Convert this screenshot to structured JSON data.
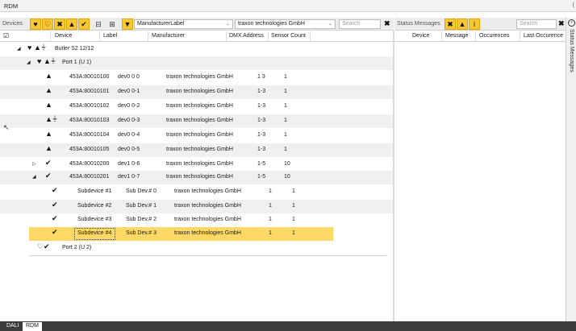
{
  "window": {
    "title": "RDM",
    "corner": "("
  },
  "toolbar": {
    "devices_label": "Devices",
    "filter_icons": [
      "heart-icon",
      "heart-outline-icon",
      "error-icon",
      "warning-icon",
      "check-icon"
    ],
    "combo1": "ManufacturerLabel",
    "combo2": "traxon technologies GmbH",
    "search_placeholder": "Search",
    "accent": "#f7c733"
  },
  "columns": [
    "Device",
    "Label",
    "Manufacturer",
    "DMX Address",
    "Sensor Count"
  ],
  "tree": {
    "root": "Butler S2 12/12",
    "port1": "Port 1 (U 1)",
    "port2": "Port 2 (U 2)"
  },
  "devices": [
    {
      "device": "453A:80010100",
      "label": "dev0 0 0",
      "manufacturer": "traxon technologies GmbH",
      "dmx": "1 3",
      "sensors": "1"
    },
    {
      "device": "453A:80010101",
      "label": "dev0 0-1",
      "manufacturer": "traxon technologies GmbH",
      "dmx": "1-3",
      "sensors": "1"
    },
    {
      "device": "453A:80010102",
      "label": "dev0 0-2",
      "manufacturer": "traxon technologies GmbH",
      "dmx": "1-3",
      "sensors": "1"
    },
    {
      "device": "453A:80010103",
      "label": "dev0 0-3",
      "manufacturer": "traxon technologies GmbH",
      "dmx": "1-3",
      "sensors": "1"
    },
    {
      "device": "453A:80010104",
      "label": "dev0 0-4",
      "manufacturer": "traxon technologies GmbH",
      "dmx": "1-3",
      "sensors": "1"
    },
    {
      "device": "453A:80010105",
      "label": "dev0 0-5",
      "manufacturer": "traxon technologies GmbH",
      "dmx": "1-3",
      "sensors": "1"
    },
    {
      "device": "453A:80010200",
      "label": "dev1 0-6",
      "manufacturer": "traxon technologies GmbH",
      "dmx": "1-5",
      "sensors": "10"
    },
    {
      "device": "453A:80010201",
      "label": "dev1 0-7",
      "manufacturer": "traxon technologies GmbH",
      "dmx": "1-5",
      "sensors": "10"
    }
  ],
  "subdevices": [
    {
      "device": "Subdevice #1",
      "label": "Sub Dev.# 0",
      "manufacturer": "traxon technologies GmbH",
      "dmx": "1",
      "sensors": "1"
    },
    {
      "device": "Subdevice #2",
      "label": "Sub Dev.# 1",
      "manufacturer": "traxon technologies GmbH",
      "dmx": "1",
      "sensors": "1"
    },
    {
      "device": "Subdevice #3",
      "label": "Sub Dev.# 2",
      "manufacturer": "traxon technologies GmbH",
      "dmx": "1",
      "sensors": "1"
    },
    {
      "device": "Subdevice #4",
      "label": "Sub Dev.# 3",
      "manufacturer": "traxon technologies GmbH",
      "dmx": "1",
      "sensors": "1"
    }
  ],
  "status": {
    "label": "Status Messages",
    "search_placeholder": "Search",
    "columns": [
      "Device",
      "Message",
      "Occurences",
      "Last Occurence"
    ],
    "side_title": "Status Messages"
  },
  "tabs": [
    "DALI",
    "RDM"
  ],
  "selection_color": "#ffd966"
}
